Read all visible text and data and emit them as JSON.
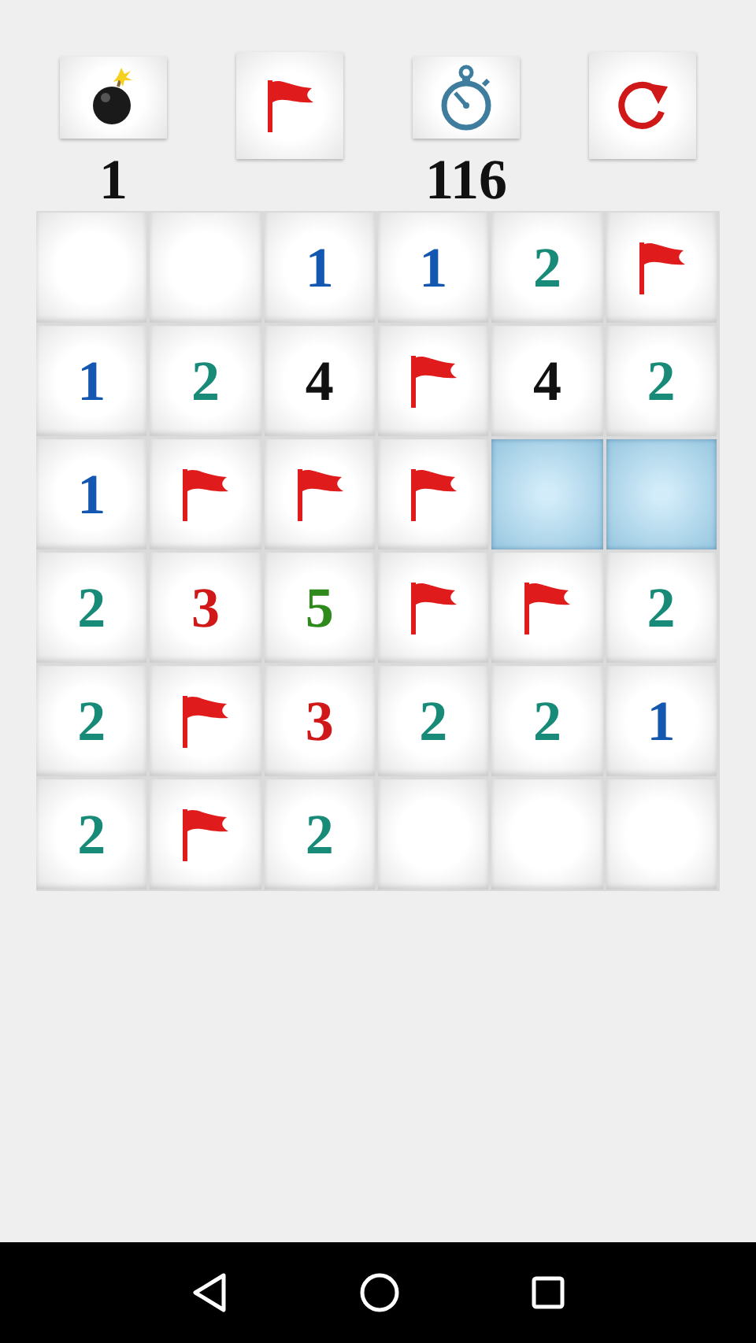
{
  "toolbar": [
    {
      "kind": "mines",
      "counter": "1"
    },
    {
      "kind": "flag"
    },
    {
      "kind": "timer",
      "counter": "116"
    },
    {
      "kind": "restart"
    }
  ],
  "board": {
    "rows": [
      [
        {
          "kind": "empty"
        },
        {
          "kind": "empty"
        },
        {
          "kind": "number",
          "text": "1",
          "color": "#1457b0"
        },
        {
          "kind": "number",
          "text": "1",
          "color": "#1457b0"
        },
        {
          "kind": "number",
          "text": "2",
          "color": "#178a78"
        },
        {
          "kind": "flag"
        }
      ],
      [
        {
          "kind": "number",
          "text": "1",
          "color": "#1457b0"
        },
        {
          "kind": "number",
          "text": "2",
          "color": "#178a78"
        },
        {
          "kind": "number",
          "text": "4",
          "color": "#111111"
        },
        {
          "kind": "flag"
        },
        {
          "kind": "number",
          "text": "4",
          "color": "#111111"
        },
        {
          "kind": "number",
          "text": "2",
          "color": "#178a78"
        }
      ],
      [
        {
          "kind": "number",
          "text": "1",
          "color": "#1457b0"
        },
        {
          "kind": "flag"
        },
        {
          "kind": "flag"
        },
        {
          "kind": "flag"
        },
        {
          "kind": "covered"
        },
        {
          "kind": "covered"
        }
      ],
      [
        {
          "kind": "number",
          "text": "2",
          "color": "#178a78"
        },
        {
          "kind": "number",
          "text": "3",
          "color": "#d01818"
        },
        {
          "kind": "number",
          "text": "5",
          "color": "#2e8a1a"
        },
        {
          "kind": "flag"
        },
        {
          "kind": "flag"
        },
        {
          "kind": "number",
          "text": "2",
          "color": "#178a78"
        }
      ],
      [
        {
          "kind": "number",
          "text": "2",
          "color": "#178a78"
        },
        {
          "kind": "flag"
        },
        {
          "kind": "number",
          "text": "3",
          "color": "#d01818"
        },
        {
          "kind": "number",
          "text": "2",
          "color": "#178a78"
        },
        {
          "kind": "number",
          "text": "2",
          "color": "#178a78"
        },
        {
          "kind": "number",
          "text": "1",
          "color": "#1457b0"
        }
      ],
      [
        {
          "kind": "number",
          "text": "2",
          "color": "#178a78"
        },
        {
          "kind": "flag"
        },
        {
          "kind": "number",
          "text": "2",
          "color": "#178a78"
        },
        {
          "kind": "empty"
        },
        {
          "kind": "empty"
        },
        {
          "kind": "empty"
        }
      ]
    ]
  },
  "nav_bar": [
    {
      "kind": "back"
    },
    {
      "kind": "home"
    },
    {
      "kind": "recents"
    }
  ]
}
